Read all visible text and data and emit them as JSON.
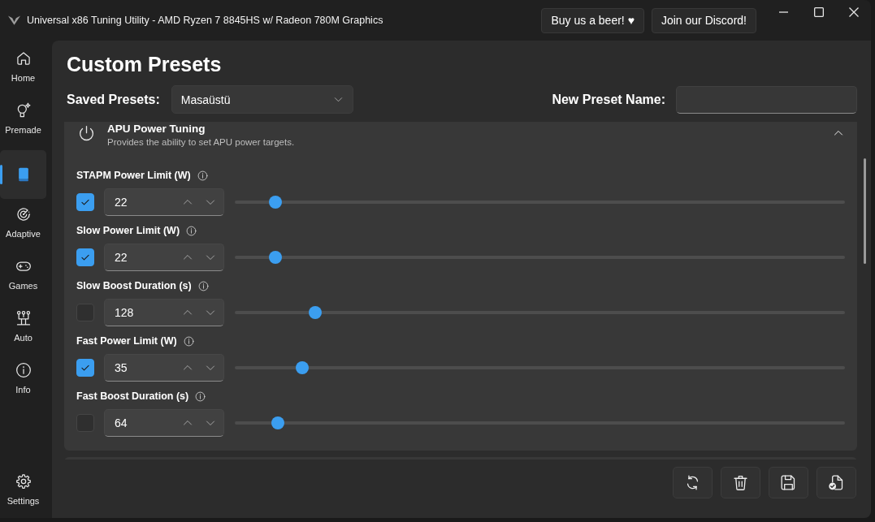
{
  "window": {
    "title": "Universal x86 Tuning Utility - AMD Ryzen 7 8845HS w/ Radeon 780M Graphics"
  },
  "header_buttons": [
    {
      "label": "Buy us a beer! ♥"
    },
    {
      "label": "Join our Discord!"
    }
  ],
  "sidebar": {
    "items": [
      {
        "kind": "home",
        "label": "Home",
        "selected": false
      },
      {
        "kind": "lightbulb",
        "label": "Premade",
        "selected": false
      },
      {
        "kind": "book",
        "selected": true
      },
      {
        "kind": "gauge",
        "label": "Adaptive",
        "selected": false
      },
      {
        "kind": "gamepad",
        "label": "Games",
        "selected": false
      },
      {
        "kind": "circuit",
        "label": "Auto",
        "selected": false
      },
      {
        "kind": "info",
        "label": "Info",
        "selected": false
      }
    ],
    "footer_items": [
      {
        "kind": "gear",
        "label": "Settings",
        "selected": false
      }
    ]
  },
  "page": {
    "title": "Custom Presets",
    "saved_presets": {
      "label": "Saved Presets:",
      "value": "Masaüstü"
    },
    "new_preset_name": {
      "label": "New Preset Name:"
    }
  },
  "section": {
    "title": "APU Power Tuning",
    "description": "Provides the ability to set APU power targets.",
    "expanded": true,
    "settings": [
      {
        "label": "STAPM Power Limit (W)",
        "enabled": true,
        "value": "22",
        "level": 0.067
      },
      {
        "label": "Slow Power Limit (W)",
        "enabled": true,
        "value": "22",
        "level": 0.067
      },
      {
        "label": "Slow Boost Duration (s)",
        "enabled": false,
        "value": "128",
        "level": 0.132
      },
      {
        "label": "Fast Power Limit (W)",
        "enabled": true,
        "value": "35",
        "level": 0.11
      },
      {
        "label": "Fast Boost Duration (s)",
        "enabled": false,
        "value": "64",
        "level": 0.07
      }
    ]
  },
  "actions": [
    {
      "kind": "refresh"
    },
    {
      "kind": "delete"
    },
    {
      "kind": "save"
    },
    {
      "kind": "apply"
    }
  ]
}
